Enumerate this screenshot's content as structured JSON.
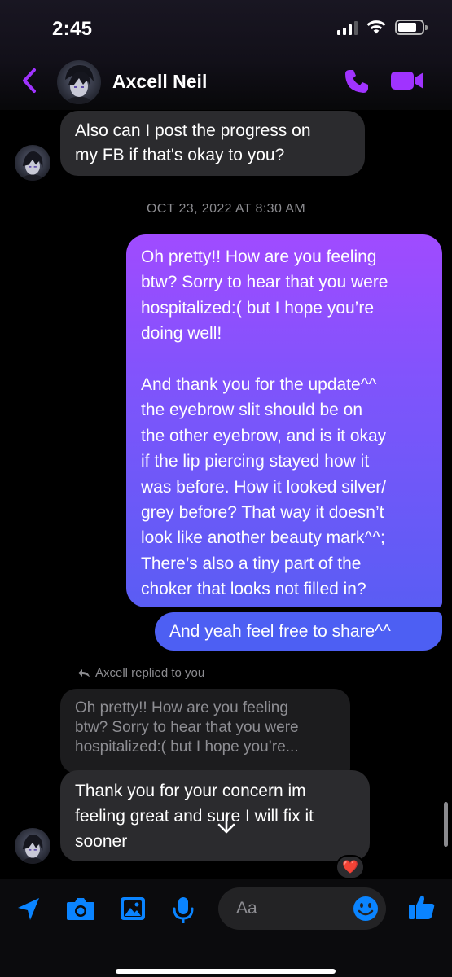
{
  "status_bar": {
    "time": "2:45"
  },
  "header": {
    "contact_name": "Axcell Neil"
  },
  "conversation": {
    "incoming_1": "Also can I post the progress on\nmy FB if that's okay to you?",
    "timestamp": "OCT 23, 2022 AT 8:30 AM",
    "outgoing_1": "Oh pretty!! How are you feeling\nbtw? Sorry to hear that you were\nhospitalized:( but I hope you’re\ndoing well!\n\nAnd thank you for the update^^\nthe eyebrow slit should be on\nthe other eyebrow, and is it okay\nif the lip piercing stayed how it\nwas before. How it looked silver/\ngrey before? That way it doesn’t\nlook like another beauty mark^^;\nThere’s also a tiny part of the\nchoker that looks not filled in?",
    "outgoing_2": "And yeah feel free to share^^",
    "reply_label": "Axcell replied to you",
    "quoted_text": "Oh pretty!! How are you feeling\nbtw? Sorry to hear that you were\nhospitalized:( but I hope you’re...",
    "incoming_2": "Thank you for your concern im\nfeeling great and sure I will fix it\nsooner",
    "reaction": "❤️"
  },
  "composer": {
    "placeholder": "Aa"
  },
  "icons": {
    "back": "chevron-left-icon",
    "call": "phone-icon",
    "video": "video-camera-icon",
    "location": "location-arrow-icon",
    "camera": "camera-icon",
    "gallery": "image-icon",
    "mic": "microphone-icon",
    "emoji": "emoji-icon",
    "like": "thumbs-up-icon",
    "scroll": "arrow-down-icon"
  },
  "colors": {
    "accent_purple": "#a033ff",
    "tool_blue": "#0a84ff",
    "bubble_gradient_top": "#9b4dff",
    "bubble_gradient_bottom": "#4a5ff2",
    "incoming_bubble": "#2b2b2e"
  }
}
